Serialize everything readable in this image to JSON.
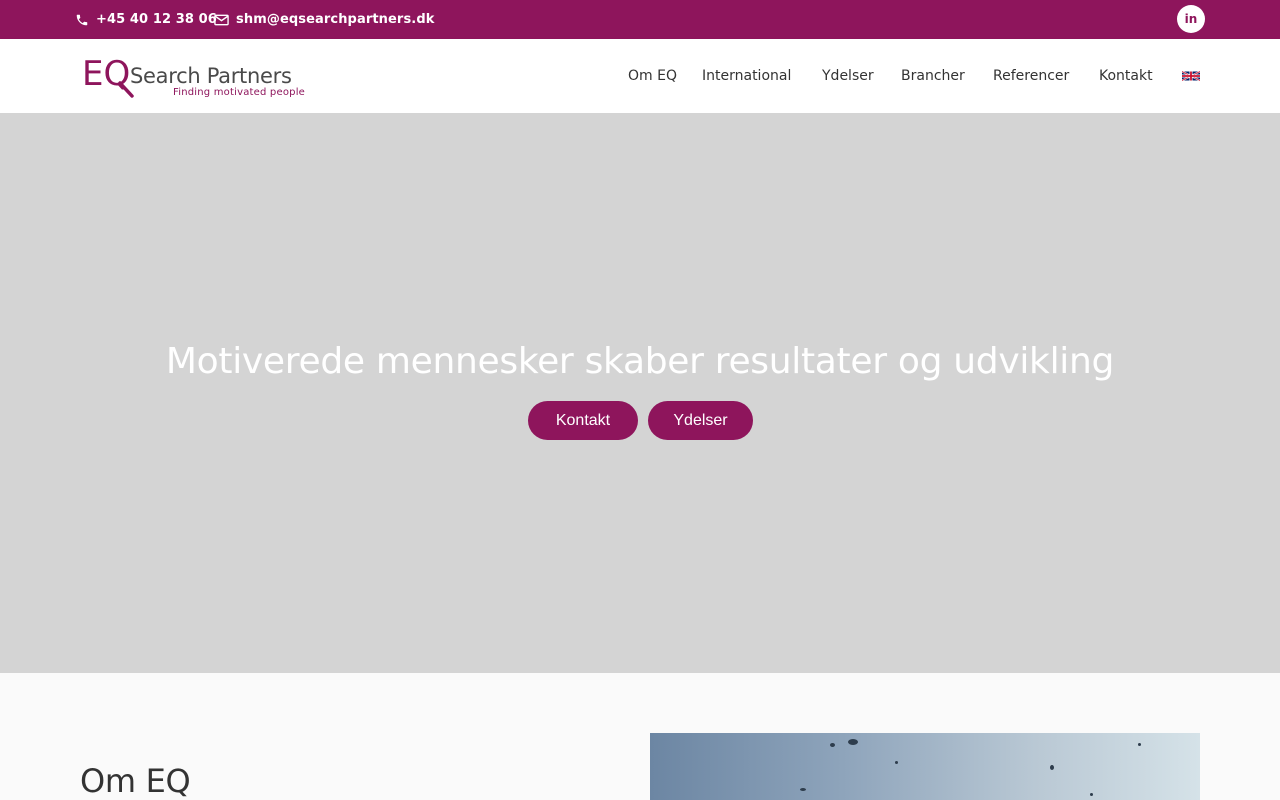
{
  "topbar": {
    "phone": "+45 40 12 38 06",
    "email": "shm@eqsearchpartners.dk",
    "linkedin_icon": "linkedin-icon",
    "background": "#8e155c"
  },
  "header": {
    "logo_mark": "EQ",
    "logo_name": "Search Partners",
    "logo_tagline": "Finding motivated people",
    "nav": [
      {
        "label": "Om EQ"
      },
      {
        "label": "International"
      },
      {
        "label": "Ydelser"
      },
      {
        "label": "Brancher"
      },
      {
        "label": "Referencer"
      },
      {
        "label": "Kontakt"
      }
    ],
    "language_icon": "uk-flag-icon"
  },
  "hero": {
    "headline": "Motiverede mennesker skaber resultater og udvikling",
    "buttons": [
      {
        "label": "Kontakt"
      },
      {
        "label": "Ydelser"
      }
    ],
    "background": "#d4d4d4"
  },
  "about": {
    "title": "Om EQ"
  },
  "colors": {
    "brand": "#8e155c",
    "text": "#333333"
  }
}
